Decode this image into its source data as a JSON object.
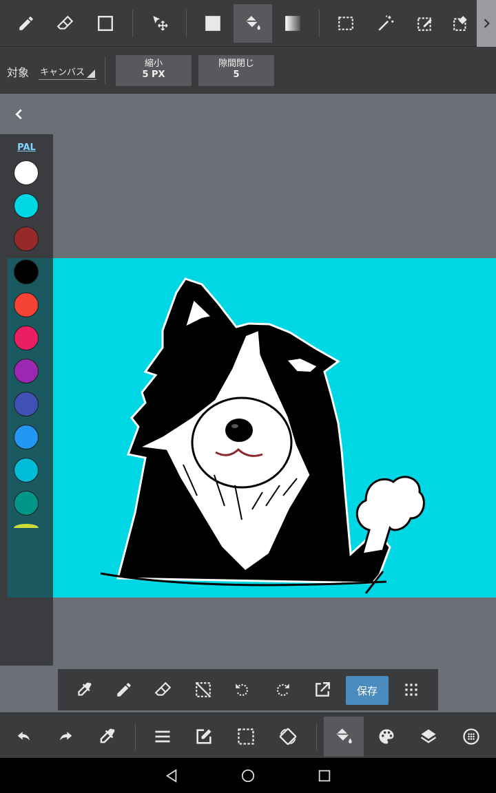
{
  "top_toolbar": {
    "tools": [
      "pen-tool",
      "eraser-tool",
      "shape-tool",
      "move-tool",
      "fill-rect-tool",
      "bucket-tool",
      "gradient-tool",
      "select-tool",
      "magic-wand-tool",
      "select-pen-tool",
      "select-eraser-tool"
    ],
    "active_tool": "bucket-tool"
  },
  "options_bar": {
    "target_label": "対象",
    "target_value": "キャンバス",
    "shrink_label": "縮小",
    "shrink_value": "5 PX",
    "gap_label": "隙間閉じ",
    "gap_value": "5"
  },
  "palette": {
    "title": "PAL",
    "colors": [
      "#ffffff",
      "#00d7e5",
      "#962a2a",
      "#000000",
      "#f44336",
      "#e91e63",
      "#9c27b0",
      "#3f51b5",
      "#2196f3",
      "#00bcd4",
      "#009688"
    ]
  },
  "canvas": {
    "background": "#00d7e5"
  },
  "bottom_toolbar": {
    "save_label": "保存"
  },
  "main_bar": {
    "active": "bucket"
  },
  "colors": {
    "bar_bg": "#3a3b3d",
    "active_bg": "#58595c",
    "save_bg": "#4b8bbd",
    "workspace": "#6b6f75"
  }
}
